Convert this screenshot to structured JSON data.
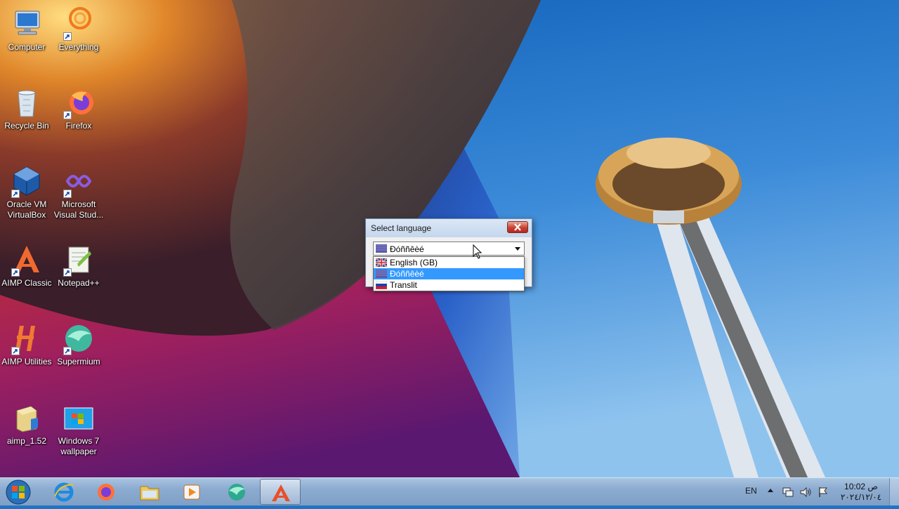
{
  "colors": {
    "selection": "#3399ff",
    "sky": "#1f74c6",
    "taskbar": "#8cabd0",
    "close_button": "#c84333"
  },
  "desktop": {
    "icons": [
      {
        "label": "Computer",
        "icon": "computer-icon"
      },
      {
        "label": "Everything",
        "icon": "everything-icon"
      },
      {
        "label": "Recycle Bin",
        "icon": "recycle-bin-icon"
      },
      {
        "label": "Firefox",
        "icon": "firefox-icon"
      },
      {
        "label": "Oracle VM VirtualBox",
        "icon": "virtualbox-icon"
      },
      {
        "label": "Microsoft Visual Stud...",
        "icon": "visual-studio-icon"
      },
      {
        "label": "AIMP Classic",
        "icon": "aimp-icon"
      },
      {
        "label": "Notepad++",
        "icon": "notepad-plus-plus-icon"
      },
      {
        "label": "AIMP Utilities",
        "icon": "aimp-utilities-icon"
      },
      {
        "label": "Supermium",
        "icon": "supermium-icon"
      },
      {
        "label": "aimp_1.52",
        "icon": "installer-icon"
      },
      {
        "label": "Windows 7 wallpaper",
        "icon": "image-file-icon"
      }
    ]
  },
  "dialog": {
    "title": "Select language",
    "close_icon": "close-icon",
    "combo": {
      "value": "Ðóññêèé",
      "arrow_icon": "chevron-down-icon"
    },
    "options": [
      {
        "label": "English (GB)",
        "flag": "uk-flag-icon"
      },
      {
        "label": "Ðóññêèé",
        "flag": "russian-flag-icon",
        "selected": true
      },
      {
        "label": "Translit",
        "flag": "russian-flag-icon"
      }
    ]
  },
  "taskbar": {
    "pinned": [
      "internet-explorer-icon",
      "firefox-icon",
      "explorer-folder-icon",
      "media-player-icon",
      "supermium-icon",
      "aimp-icon"
    ],
    "tray": {
      "language": "EN",
      "time": "10:02 ص",
      "date": "٢٠٢٤/١٢/٠٤"
    }
  }
}
